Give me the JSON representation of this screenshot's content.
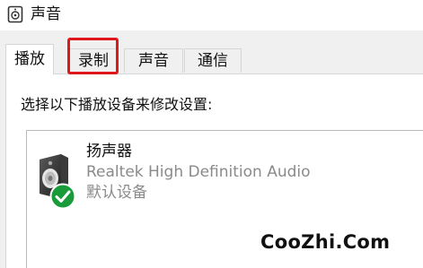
{
  "window": {
    "title": "声音",
    "icon": "speaker-icon"
  },
  "tabs": [
    {
      "label": "播放",
      "active": true
    },
    {
      "label": "录制",
      "active": false,
      "highlighted": true
    },
    {
      "label": "声音",
      "active": false
    },
    {
      "label": "通信",
      "active": false
    }
  ],
  "panel": {
    "instruction": "选择以下播放设备来修改设置:"
  },
  "devices": [
    {
      "name": "扬声器",
      "description": "Realtek High Definition Audio",
      "status": "默认设备",
      "icon": "speaker-icon",
      "badge": "green-check-icon"
    }
  ],
  "watermark": {
    "text": "CooZhi.Com"
  },
  "colors": {
    "highlight": "#e0161b",
    "check_badge": "#1a9b3a",
    "secondary_text": "#8a8a8a"
  }
}
